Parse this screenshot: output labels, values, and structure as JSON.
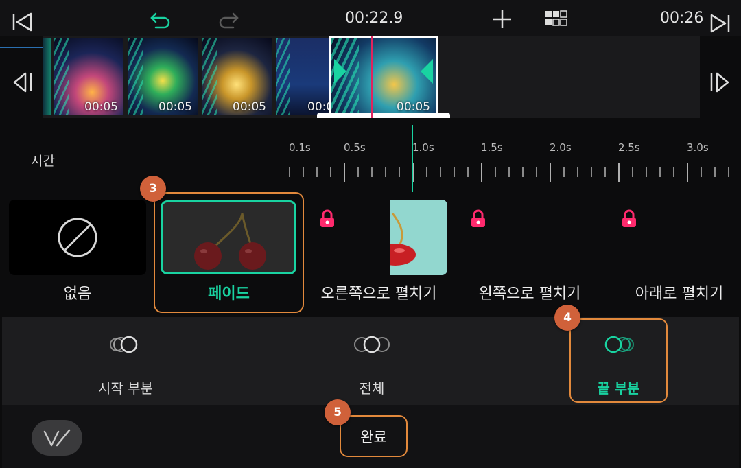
{
  "top_bar": {
    "current_time": "00:22.9",
    "total_time": "00:26",
    "icons": [
      "skip-to-start-icon",
      "undo-icon",
      "redo-icon",
      "add-icon",
      "grid-icon",
      "skip-to-end-icon"
    ]
  },
  "timeline": {
    "clips": [
      {
        "duration": "00:05"
      },
      {
        "duration": "00:05"
      },
      {
        "duration": "00:05"
      },
      {
        "duration": "00:0"
      },
      {
        "duration": "00:05"
      }
    ]
  },
  "ruler": {
    "label": "시간",
    "ticks": [
      "0.1s",
      "0.5s",
      "1.0s",
      "1.5s",
      "2.0s",
      "2.5s",
      "3.0s"
    ]
  },
  "transitions": {
    "items": [
      {
        "label": "없음"
      },
      {
        "label": "페이드",
        "selected": true
      },
      {
        "label": "오른쪽으로 펼치기",
        "locked": true
      },
      {
        "label": "왼쪽으로 펼치기",
        "locked": true
      },
      {
        "label": "아래로 펼치기",
        "locked": true
      }
    ]
  },
  "modes": {
    "items": [
      {
        "label": "시작 부분"
      },
      {
        "label": "전체"
      },
      {
        "label": "끝 부분",
        "selected": true
      }
    ]
  },
  "bottom": {
    "done_label": "완료"
  },
  "annotations": {
    "step3": "3",
    "step4": "4",
    "step5": "5"
  },
  "colors": {
    "accent": "#19d3a1",
    "playhead": "#e0245e",
    "lock": "#ff2a6d",
    "annotation": "#d0613a"
  }
}
